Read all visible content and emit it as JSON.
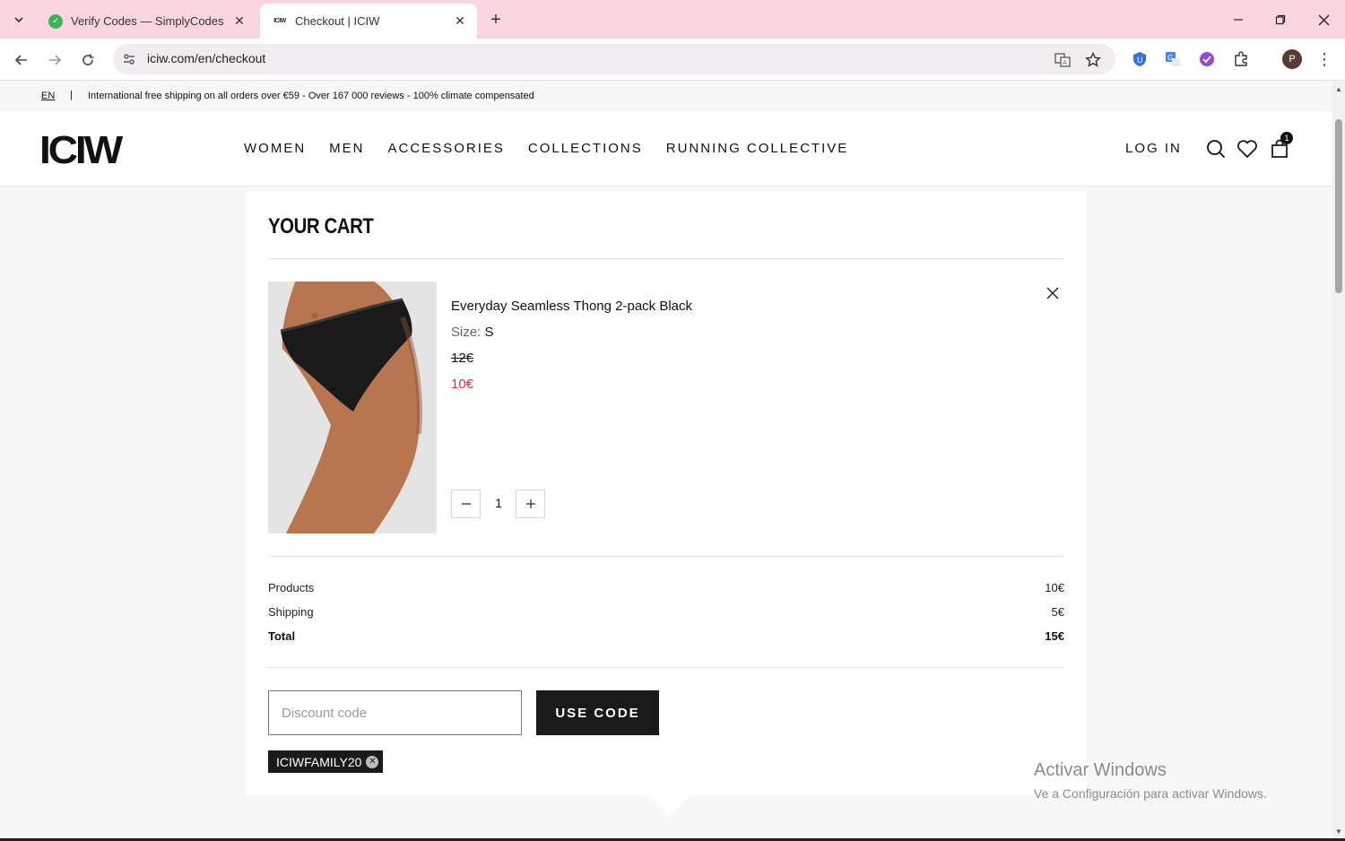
{
  "browser": {
    "tabs": [
      {
        "title": "Verify Codes — SimplyCodes",
        "active": false
      },
      {
        "title": "Checkout | ICIW",
        "active": true
      }
    ],
    "favicon_iciw": "ICIW",
    "url": "iciw.com/en/checkout",
    "profile_initial": "P",
    "colors": {
      "tabbar": "#f9d6df",
      "omnibox": "#f1ecef"
    }
  },
  "announcement": {
    "lang": "EN",
    "separator": "|",
    "message": "International free shipping on all orders over €59 - Over 167 000 reviews - 100% climate compensated"
  },
  "header": {
    "logo": "ICIW",
    "nav": [
      "WOMEN",
      "MEN",
      "ACCESSORIES",
      "COLLECTIONS",
      "RUNNING COLLECTIVE"
    ],
    "login": "LOG IN",
    "cart_count": "1"
  },
  "cart": {
    "title": "YOUR CART",
    "item": {
      "name": "Everyday Seamless Thong 2-pack Black",
      "size_label": "Size:",
      "size_value": "S",
      "price_original": "12€",
      "price_sale": "10€",
      "quantity": "1"
    },
    "summary": {
      "products_label": "Products",
      "products_value": "10€",
      "shipping_label": "Shipping",
      "shipping_value": "5€",
      "total_label": "Total",
      "total_value": "15€"
    },
    "discount": {
      "placeholder": "Discount code",
      "button": "USE CODE",
      "applied_code": "ICIWFAMILY20"
    },
    "colors": {
      "sale_price": "#d1333a",
      "button": "#1a1a1a"
    }
  },
  "watermark": {
    "line1": "Activar Windows",
    "line2": "Ve a Configuración para activar Windows."
  }
}
